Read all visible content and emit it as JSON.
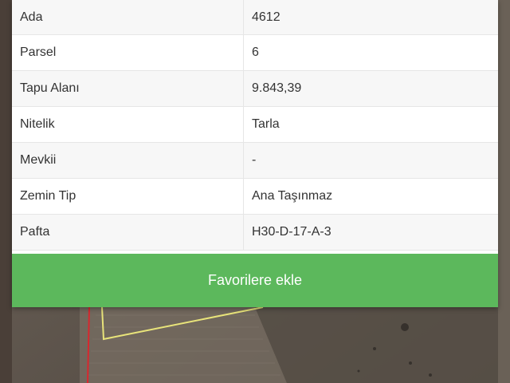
{
  "parcel_info": {
    "rows": [
      {
        "key": "Ada",
        "value": "4612"
      },
      {
        "key": "Parsel",
        "value": "6"
      },
      {
        "key": "Tapu Alanı",
        "value": "9.843,39"
      },
      {
        "key": "Nitelik",
        "value": "Tarla"
      },
      {
        "key": "Mevkii",
        "value": "-"
      },
      {
        "key": "Zemin Tip",
        "value": "Ana Taşınmaz"
      },
      {
        "key": "Pafta",
        "value": "H30-D-17-A-3"
      }
    ]
  },
  "actions": {
    "favorite_label": "Favorilere ekle"
  },
  "colors": {
    "button": "#5cb85c",
    "parcel_outline": "#e8e37a",
    "boundary_line": "#d9272e"
  }
}
